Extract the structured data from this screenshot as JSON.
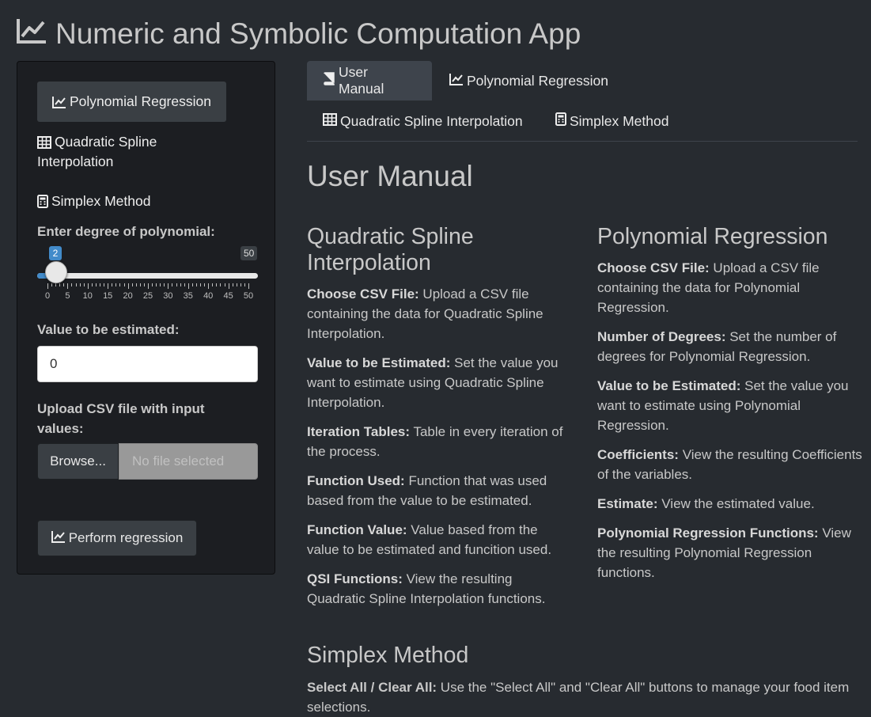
{
  "app": {
    "title": "Numeric and Symbolic Computation App",
    "title_icon": "line-chart-icon"
  },
  "sidebar": {
    "nav": [
      {
        "label": "Polynomial Regression",
        "icon": "line-chart-icon",
        "active": true
      },
      {
        "label": "Quadratic Spline Interpolation",
        "icon": "table-icon",
        "active": false
      },
      {
        "label": "Simplex Method",
        "icon": "calculator-icon",
        "active": false
      }
    ],
    "degree_label": "Enter degree of polynomial:",
    "slider": {
      "min": 0,
      "max": 50,
      "value": 2,
      "value_label": "2",
      "max_label": "50",
      "tick_labels": [
        "0",
        "5",
        "10",
        "15",
        "20",
        "25",
        "30",
        "35",
        "40",
        "45",
        "50"
      ]
    },
    "estimate_label": "Value to be estimated:",
    "estimate_value": "0",
    "upload_label": "Upload CSV file with input values:",
    "browse_label": "Browse...",
    "file_placeholder": "No file selected",
    "perform_label": "Perform regression"
  },
  "tabs": [
    {
      "label": "User Manual",
      "icon": "book-icon",
      "active": true
    },
    {
      "label": "Polynomial Regression",
      "icon": "line-chart-icon",
      "active": false
    },
    {
      "label": "Quadratic Spline Interpolation",
      "icon": "table-icon",
      "active": false
    },
    {
      "label": "Simplex Method",
      "icon": "calculator-icon",
      "active": false
    }
  ],
  "manual": {
    "heading": "User Manual",
    "qsi": {
      "heading": "Quadratic Spline Interpolation",
      "items": [
        {
          "term": "Choose CSV File:",
          "text": " Upload a CSV file containing the data for Quadratic Spline Interpolation."
        },
        {
          "term": "Value to be Estimated:",
          "text": " Set the value you want to estimate using Quadratic Spline Interpolation."
        },
        {
          "term": "Iteration Tables:",
          "text": " Table in every iteration of the process."
        },
        {
          "term": "Function Used:",
          "text": " Function that was used based from the value to be estimated."
        },
        {
          "term": "Function Value:",
          "text": " Value based from the value to be estimated and funcition used."
        },
        {
          "term": "QSI Functions:",
          "text": " View the resulting Quadratic Spline Interpolation functions."
        }
      ]
    },
    "pr": {
      "heading": "Polynomial Regression",
      "items": [
        {
          "term": "Choose CSV File:",
          "text": " Upload a CSV file containing the data for Polynomial Regression."
        },
        {
          "term": "Number of Degrees:",
          "text": " Set the number of degrees for Polynomial Regression."
        },
        {
          "term": "Value to be Estimated:",
          "text": " Set the value you want to estimate using Polynomial Regression."
        },
        {
          "term": "Coefficients:",
          "text": " View the resulting Coefficients of the variables."
        },
        {
          "term": "Estimate:",
          "text": " View the estimated value."
        },
        {
          "term": "Polynomial Regression Functions:",
          "text": " View the resulting Polynomial Regression functions."
        }
      ]
    },
    "simplex": {
      "heading": "Simplex Method",
      "items": [
        {
          "term": "Select All / Clear All:",
          "text": " Use the \"Select All\" and \"Clear All\" buttons to manage your food item selections."
        }
      ]
    }
  },
  "colors": {
    "background": "#272b30",
    "sidebar": "#1c1e22",
    "accent": "#428bca",
    "text": "#c8c8c8"
  }
}
